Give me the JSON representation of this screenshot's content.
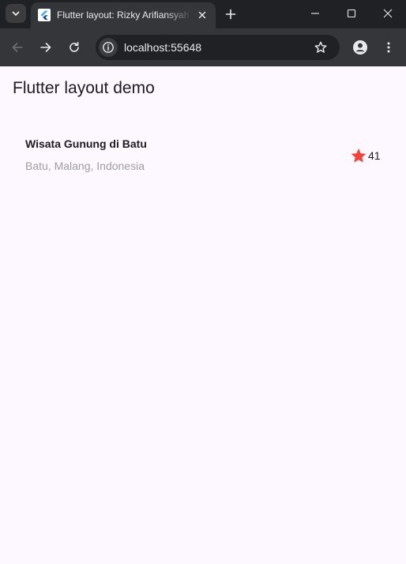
{
  "browser": {
    "tab": {
      "title": "Flutter layout: Rizky Arifiansyah",
      "favicon": "flutter-logo-icon"
    },
    "url": "localhost:55648",
    "icons": {
      "tab_search": "chevron-down-icon",
      "tab_close": "close-icon",
      "new_tab": "plus-icon",
      "minimize": "minimize-icon",
      "maximize": "maximize-icon",
      "close_window": "close-icon",
      "back": "arrow-left-icon",
      "forward": "arrow-right-icon",
      "reload": "reload-icon",
      "site_info": "info-icon",
      "bookmark": "star-outline-icon",
      "profile": "account-icon",
      "menu": "kebab-menu-icon"
    },
    "colors": {
      "frame": "#202124",
      "toolbar": "#35363a",
      "text": "#e8eaed"
    }
  },
  "app": {
    "appbar_title": "Flutter layout demo",
    "title_section": {
      "name": "Wisata Gunung di Batu",
      "location": "Batu, Malang, Indonesia",
      "rating_count": "41",
      "rating_icon": "star-icon"
    },
    "colors": {
      "background": "#fdf7ff",
      "text": "#1d1b20",
      "location_text": "#9e9e9e",
      "star": "#f44336"
    }
  }
}
